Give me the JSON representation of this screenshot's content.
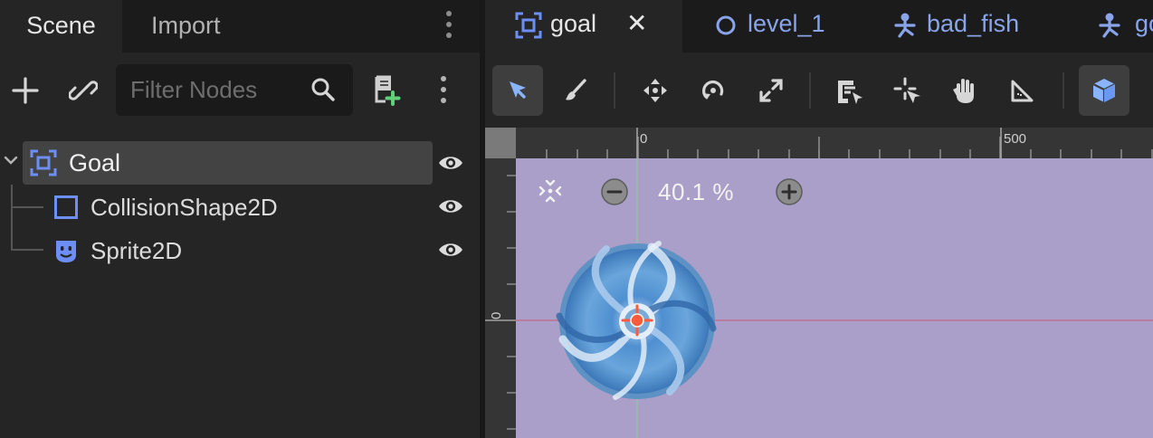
{
  "scene_dock": {
    "tabs": {
      "scene": "Scene",
      "import": "Import"
    },
    "filter_placeholder": "Filter Nodes",
    "tree": {
      "root": "Goal",
      "children": [
        "CollisionShape2D",
        "Sprite2D"
      ]
    }
  },
  "editor": {
    "tabs": [
      {
        "label": "goal",
        "icon": "area2d-icon"
      },
      {
        "label": "level_1",
        "icon": "node2d-circle-icon"
      },
      {
        "label": "bad_fish",
        "icon": "character-body-icon"
      },
      {
        "label": "go",
        "icon": "character-body-icon"
      }
    ],
    "close_glyph": "✕",
    "ruler": {
      "top_zero": "0",
      "top_500": "500",
      "left_zero": "0"
    },
    "zoom_label": "40.1 %"
  },
  "colors": {
    "accent_blue": "#8aa4ea",
    "node_blue": "#6d8ff5",
    "viewport_bg": "#a99fc8",
    "selected_row": "#434343"
  }
}
